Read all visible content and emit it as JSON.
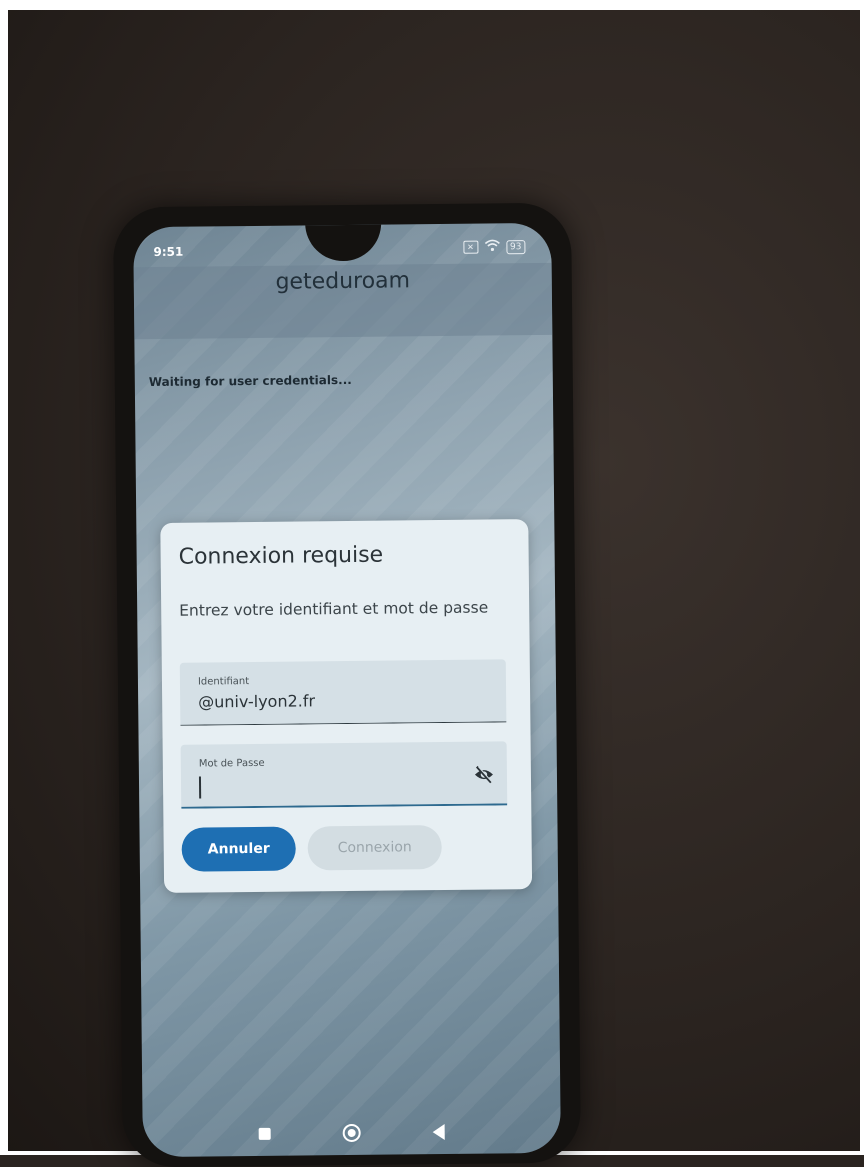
{
  "status_bar": {
    "time": "9:51",
    "battery": "93"
  },
  "app": {
    "title": "geteduroam",
    "status_text": "Waiting for user credentials..."
  },
  "dialog": {
    "title": "Connexion requise",
    "message": "Entrez votre identifiant et mot de passe",
    "identifier": {
      "label": "Identifiant",
      "value": "@univ-lyon2.fr"
    },
    "password": {
      "label": "Mot de Passe",
      "value": ""
    },
    "buttons": {
      "cancel": "Annuler",
      "connect": "Connexion"
    }
  },
  "colors": {
    "accent": "#1e6fb3",
    "dialog_bg": "#e7eff3"
  },
  "icons": [
    "sim-icon",
    "wifi-icon",
    "battery-icon",
    "eye-off-icon",
    "recents-icon",
    "home-icon",
    "back-icon"
  ]
}
